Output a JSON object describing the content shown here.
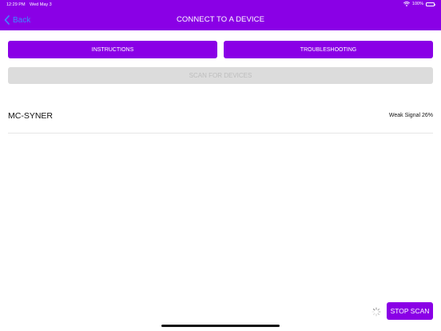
{
  "status_bar": {
    "time": "12:29 PM",
    "date": "Wed May 3",
    "battery": "100%",
    "wifi_icon": "wifi-icon",
    "battery_icon": "battery-icon"
  },
  "nav": {
    "back_label": "Back",
    "back_icon": "chevron-left-icon",
    "title": "CONNECT TO A DEVICE"
  },
  "buttons": {
    "instructions": "INSTRUCTIONS",
    "troubleshooting": "TROUBLESHOOTING",
    "scan": "SCAN FOR DEVICES",
    "stop_scan": "STOP SCAN"
  },
  "devices": [
    {
      "name": "MC-SYNER",
      "signal": "Weak Signal 26%"
    }
  ],
  "colors": {
    "brand_purple": "#8a00e6",
    "back_link_blue": "#3d8bff",
    "disabled_gray": "#dcdcdc"
  }
}
